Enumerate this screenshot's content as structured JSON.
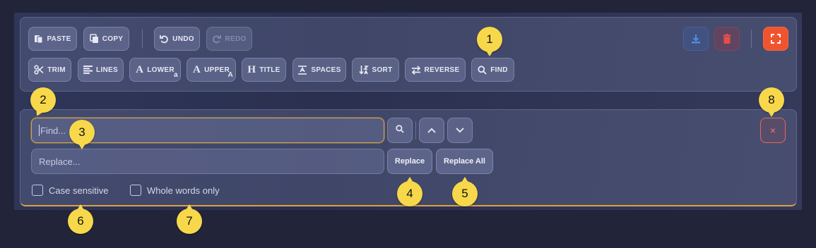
{
  "toolbar": {
    "row1": {
      "paste": "PASTE",
      "copy": "COPY",
      "undo": "UNDO",
      "redo": "REDO"
    },
    "row2": {
      "trim": "TRIM",
      "lines": "LINES",
      "lower": "LOWER",
      "lower_sub": "a",
      "upper": "UPPER",
      "upper_sub": "A",
      "title": "TITLE",
      "spaces": "SPACES",
      "sort": "SORT",
      "reverse": "REVERSE",
      "find": "FIND"
    }
  },
  "find_panel": {
    "find_placeholder": "Find...",
    "replace_placeholder": "Replace...",
    "replace_label": "Replace",
    "replace_all_label": "Replace All",
    "close_glyph": "×",
    "case_sensitive_label": "Case sensitive",
    "whole_words_label": "Whole words only"
  },
  "markers": [
    "1",
    "2",
    "3",
    "4",
    "5",
    "6",
    "7",
    "8"
  ],
  "colors": {
    "accent_orange": "#f0532e",
    "marker_yellow": "#f7d84a",
    "focus_border": "#d6a24a",
    "close_red": "#e06a5a"
  }
}
